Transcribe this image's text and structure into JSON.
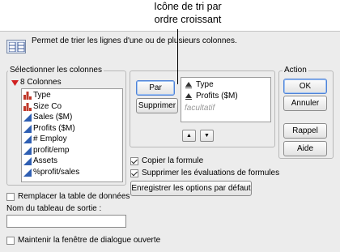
{
  "callout": {
    "line1": "Icône de tri par",
    "line2": "ordre croissant"
  },
  "header": {
    "description": "Permet de trier les lignes d'une ou de plusieurs colonnes."
  },
  "columns_panel": {
    "title": "Sélectionner les colonnes",
    "count_label": "8 Colonnes",
    "items": [
      {
        "label": "Type",
        "icon": "nominal-bar-icon",
        "color": "#c0392b"
      },
      {
        "label": "Size Co",
        "icon": "nominal-bar-icon",
        "color": "#c0392b"
      },
      {
        "label": "Sales ($M)",
        "icon": "continuous-triangle-icon",
        "color": "#2f5fb3"
      },
      {
        "label": "Profits ($M)",
        "icon": "continuous-triangle-icon",
        "color": "#2f5fb3"
      },
      {
        "label": "# Employ",
        "icon": "continuous-triangle-icon",
        "color": "#2f5fb3"
      },
      {
        "label": "profit/emp",
        "icon": "continuous-triangle-icon",
        "color": "#2f5fb3"
      },
      {
        "label": "Assets",
        "icon": "continuous-triangle-icon",
        "color": "#2f5fb3"
      },
      {
        "label": "%profit/sales",
        "icon": "continuous-triangle-icon",
        "color": "#2f5fb3"
      }
    ]
  },
  "sort_panel": {
    "by_button": "Par",
    "remove_button": "Supprimer",
    "sort_items": [
      {
        "label": "Type",
        "icon": "sort-ascending-icon"
      },
      {
        "label": "Profits ($M)",
        "icon": "sort-ascending-icon"
      }
    ],
    "optional_placeholder": "facultatif",
    "ascending_button": "▲",
    "descending_button": "▼"
  },
  "options": {
    "copy_formula": {
      "label": "Copier la formule",
      "checked": true
    },
    "remove_formula_evals": {
      "label": "Supprimer les évaluations de formules",
      "checked": true
    },
    "save_defaults_button": "Enregistrer les options par défaut",
    "replace_table": {
      "label": "Remplacer la table de données",
      "checked": false
    },
    "output_table_label": "Nom du tableau de sortie :",
    "output_table_value": "",
    "keep_dialog_open": {
      "label": "Maintenir la fenêtre de dialogue ouverte",
      "checked": false
    }
  },
  "action_panel": {
    "title": "Action",
    "ok": "OK",
    "cancel": "Annuler",
    "recall": "Rappel",
    "help": "Aide"
  }
}
